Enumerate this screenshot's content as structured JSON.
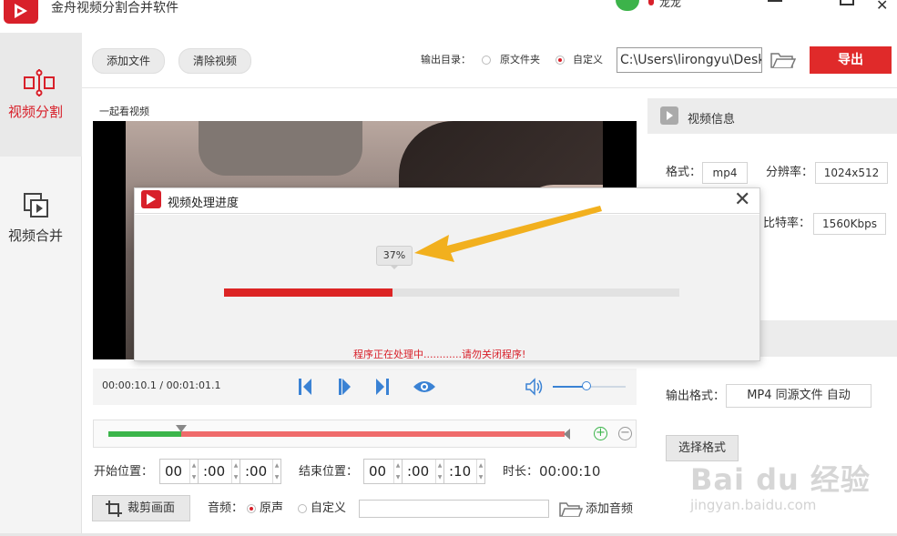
{
  "app": {
    "title": "金舟视频分割合并软件",
    "login_label": "龙龙"
  },
  "sidebar": {
    "items": [
      {
        "label": "视频分割",
        "active": true
      },
      {
        "label": "视频合并",
        "active": false
      }
    ]
  },
  "toolbar": {
    "add_file": "添加文件",
    "clear_video": "清除视频",
    "output_dir_label": "输出目录：",
    "option_source_folder": "原文件夹",
    "option_custom": "自定义",
    "output_path": "C:\\Users\\lirongyu\\Desk",
    "export_button": "导出"
  },
  "video": {
    "title": "一起看视频",
    "time_display": "00:00:10.1 / 00:01:01.1",
    "volume_level": 0.46
  },
  "trim": {
    "start_label": "开始位置：",
    "start_h": "00",
    "start_m": ":00",
    "start_s": ":00",
    "end_label": "结束位置：",
    "end_h": "00",
    "end_m": ":00",
    "end_s": ":10",
    "duration_label": "时长：",
    "duration_value": "00:00:10",
    "selection_start_fraction": 0.16,
    "selection_end_fraction": 1.0
  },
  "bottom": {
    "crop_button": "裁剪画面",
    "audio_label": "音频：",
    "audio_original": "原声",
    "audio_custom": "自定义",
    "add_audio": "添加音频"
  },
  "info": {
    "header": "视频信息",
    "format_label": "格式：",
    "format_value": "mp4",
    "resolution_label": "分辨率：",
    "resolution_value": "1024x512",
    "bitrate_label": "比特率：",
    "bitrate_value": "1560Kbps",
    "output_format_label": "输出格式：",
    "output_format_value": "MP4 同源文件 自动",
    "choose_format_button": "选择格式"
  },
  "dialog": {
    "title": "视频处理进度",
    "percent_text": "37%",
    "progress": 0.37,
    "message": "程序正在处理中............请勿关闭程序!"
  },
  "watermark": {
    "line1": "Bai du 经验",
    "line2": "jingyan.baidu.com"
  },
  "colors": {
    "brand_red": "#d8202a",
    "progress_red": "#dc2424",
    "timeline_green": "#3bb54a",
    "timeline_red": "#ef6b6b",
    "accent_blue": "#3a82d4",
    "arrow_orange": "#f2b01e"
  }
}
